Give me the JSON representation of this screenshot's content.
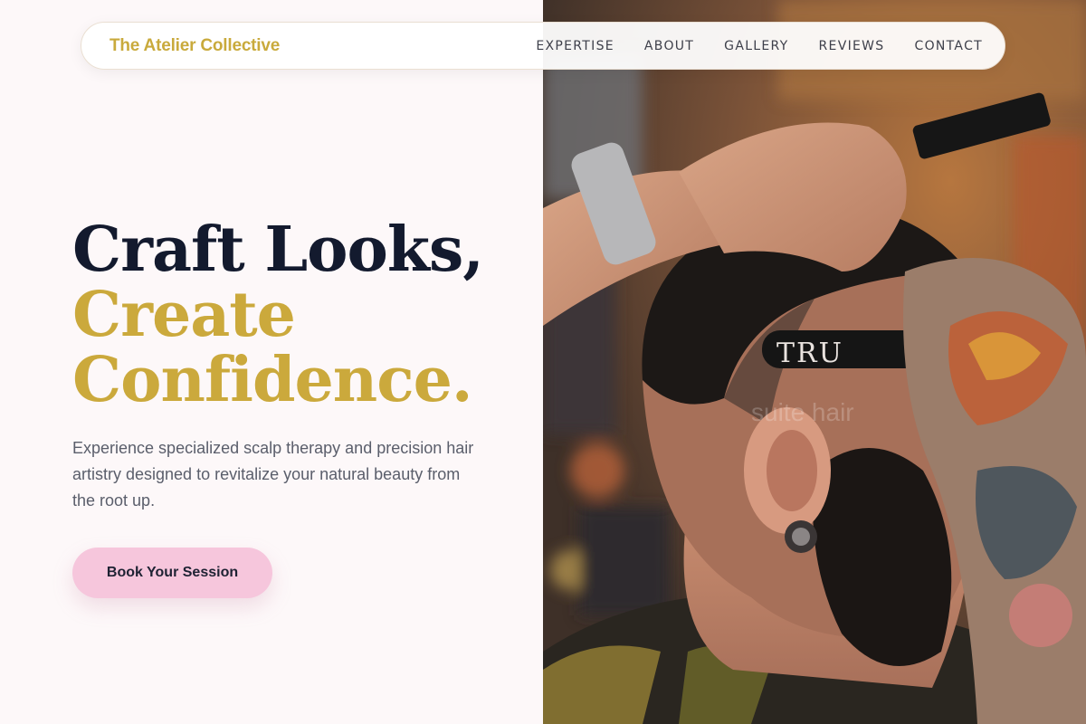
{
  "nav": {
    "brand": "The Atelier Collective",
    "links": [
      {
        "label": "EXPERTISE"
      },
      {
        "label": "ABOUT"
      },
      {
        "label": "GALLERY"
      },
      {
        "label": "REVIEWS"
      },
      {
        "label": "CONTACT"
      }
    ]
  },
  "hero": {
    "title_line1": "Craft Looks,",
    "title_line2": "Create",
    "title_line3": "Confidence.",
    "description": "Experience specialized scalp therapy and precision hair artistry designed to revitalize your natural beauty from the root up.",
    "cta_label": "Book Your Session"
  },
  "photo": {
    "razor_text": "TRU",
    "watermark": "suite hair"
  },
  "colors": {
    "accent_gold": "#cba93c",
    "dark_text": "#131a2e",
    "cta_pink": "#f6c6dc",
    "background": "#fdf8f9"
  }
}
